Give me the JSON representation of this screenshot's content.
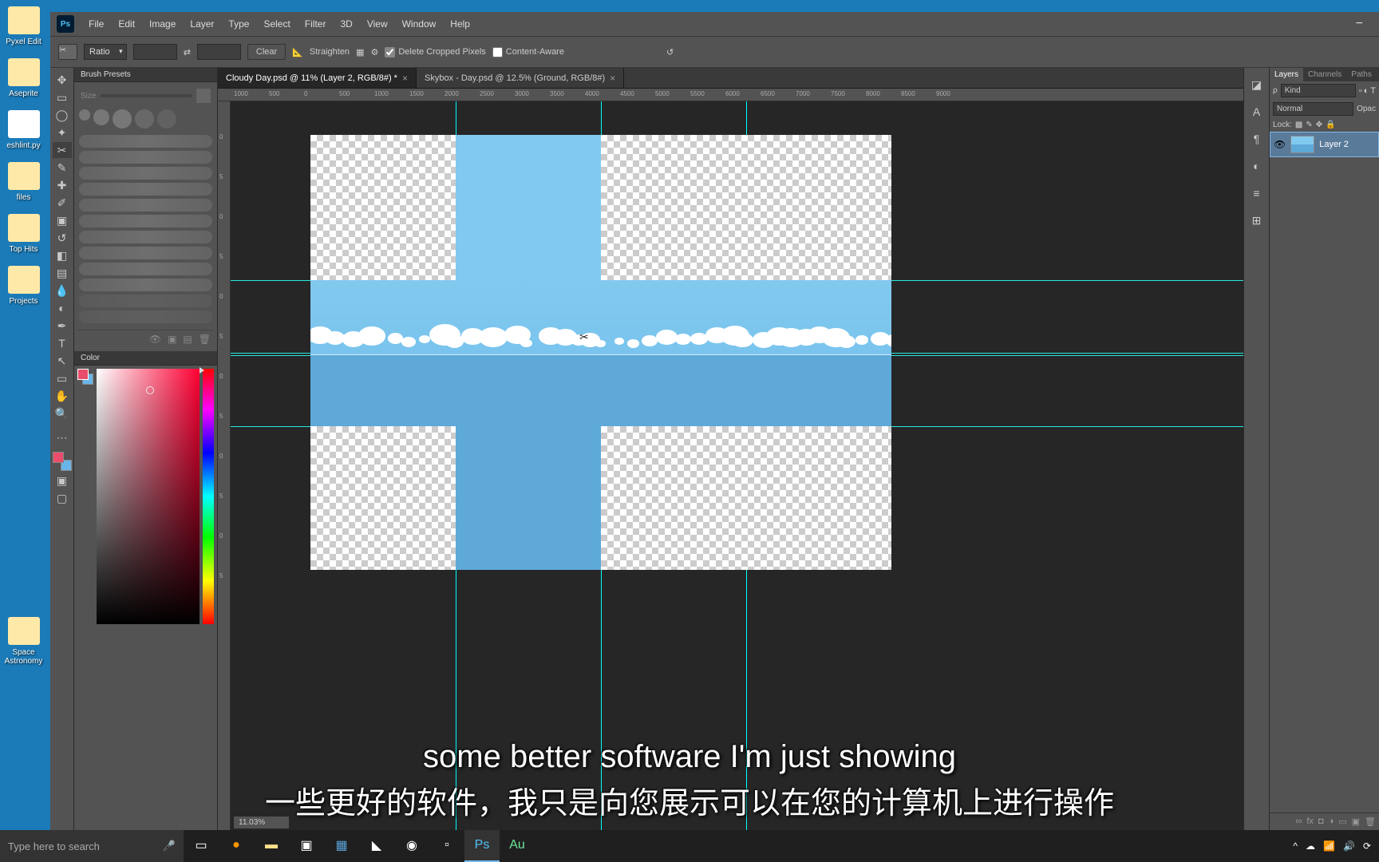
{
  "desktop": {
    "icons": [
      {
        "label": "Pyxel Edit"
      },
      {
        "label": "Aseprite"
      },
      {
        "label": "eshlint.py"
      },
      {
        "label": "files"
      },
      {
        "label": "Top Hits"
      },
      {
        "label": "Projects"
      },
      {
        "label": "Space Astronomy"
      }
    ]
  },
  "ps": {
    "logo": "Ps",
    "menu": [
      "File",
      "Edit",
      "Image",
      "Layer",
      "Type",
      "Select",
      "Filter",
      "3D",
      "View",
      "Window",
      "Help"
    ],
    "options": {
      "ratio_label": "Ratio",
      "clear": "Clear",
      "straighten": "Straighten",
      "delete_cropped": "Delete Cropped Pixels",
      "content_aware": "Content-Aware"
    },
    "tabs": [
      {
        "title": "Cloudy Day.psd @ 11% (Layer 2, RGB/8#) *",
        "active": true
      },
      {
        "title": "Skybox - Day.psd @ 12.5% (Ground, RGB/8#)",
        "active": false
      }
    ],
    "ruler_h": [
      "1000",
      "500",
      "0",
      "500",
      "1000",
      "1500",
      "2000",
      "2500",
      "3000",
      "3500",
      "4000",
      "4500",
      "5000",
      "5500",
      "6000",
      "6500",
      "7000",
      "7500",
      "8000",
      "8500",
      "9000"
    ],
    "ruler_v": [
      "0",
      "5",
      "0",
      "5",
      "0",
      "5",
      "0",
      "5",
      "0",
      "5",
      "0",
      "5"
    ],
    "zoom": "11.03%",
    "panels": {
      "brush_title": "Brush Presets",
      "brush_size": "Size",
      "color_title": "Color"
    },
    "right": {
      "tabs": [
        "Layers",
        "Channels",
        "Paths"
      ],
      "kind_label": "Kind",
      "blend_mode": "Normal",
      "opacity_label": "Opac",
      "lock_label": "Lock:",
      "layer_name": "Layer 2"
    }
  },
  "subtitles": {
    "en": "some better software I'm just showing",
    "zh": "一些更好的软件，我只是向您展示可以在您的计算机上进行操作"
  },
  "taskbar": {
    "search_placeholder": "Type here to search"
  }
}
